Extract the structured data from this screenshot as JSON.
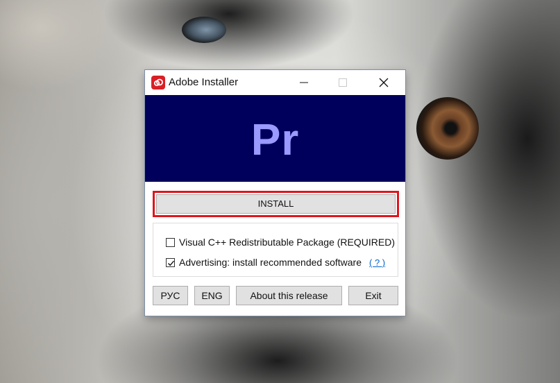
{
  "window": {
    "title": "Adobe Installer",
    "icon": "adobe-creative-cloud-icon",
    "controls": [
      "minimize-icon",
      "maximize-icon",
      "close-icon"
    ]
  },
  "banner": {
    "logo_text": "Pr",
    "background_color": "#00005c",
    "logo_color": "#9a9aff"
  },
  "install": {
    "label": "INSTALL",
    "highlight_color": "#e0141c"
  },
  "options": {
    "vcredist": {
      "label": "Visual C++ Redistributable Package (REQUIRED)",
      "checked": false
    },
    "advertising": {
      "label": "Advertising: install recommended software",
      "checked": true,
      "help_link": "( ? )"
    }
  },
  "footer": {
    "rus_label": "РУС",
    "eng_label": "ENG",
    "about_label": "About this release",
    "exit_label": "Exit"
  }
}
